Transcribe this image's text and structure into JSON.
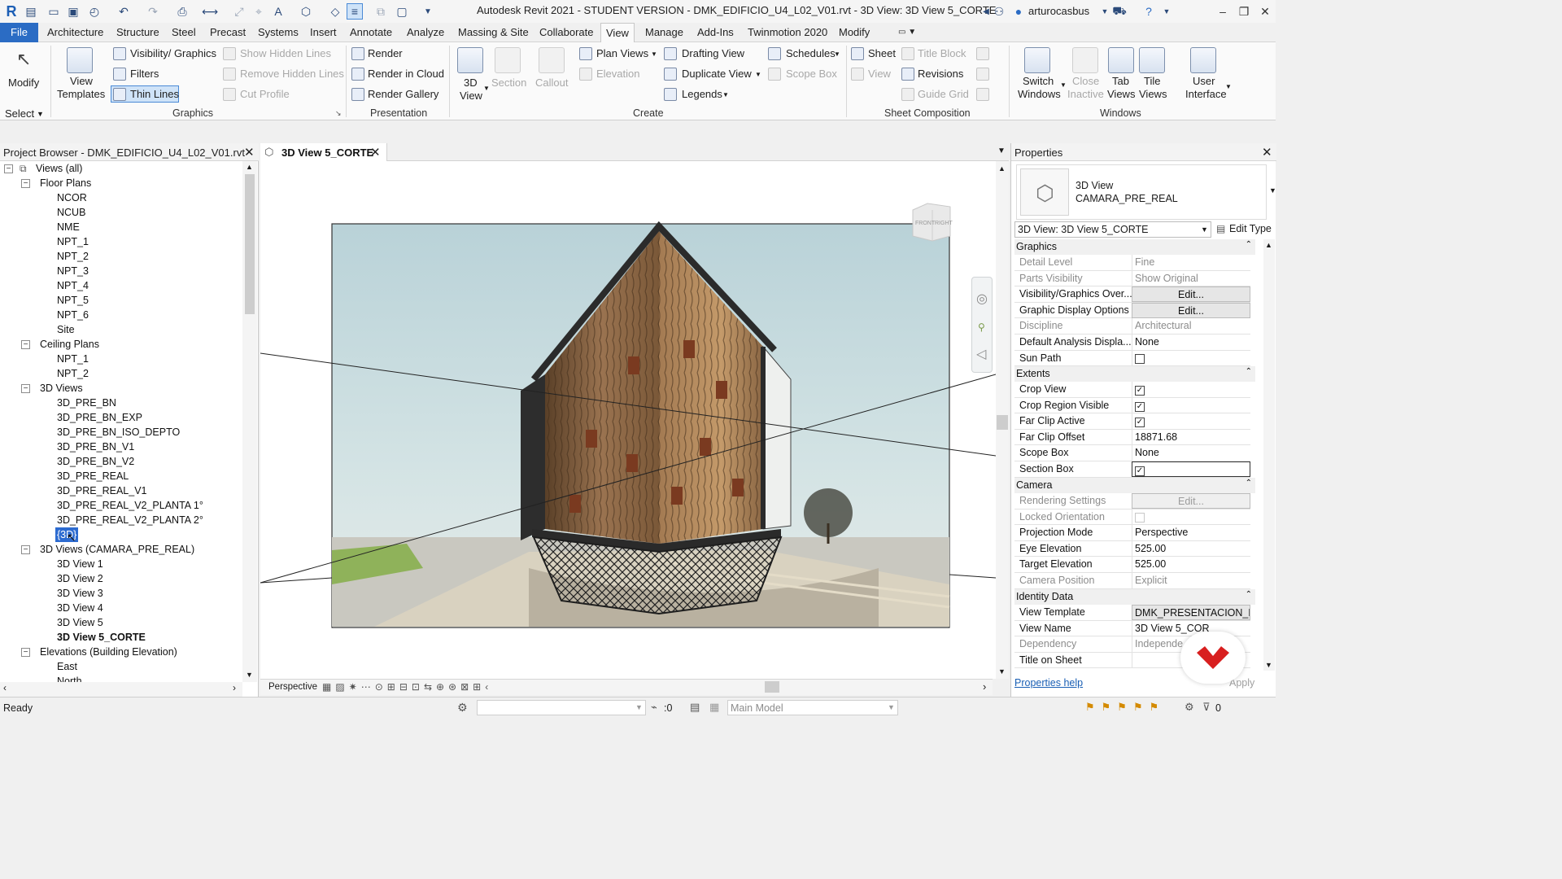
{
  "app": {
    "title": "Autodesk Revit 2021 - STUDENT VERSION - DMK_EDIFICIO_U4_L02_V01.rvt - 3D View: 3D View 5_CORTE",
    "user": "arturocasbus",
    "logo": "R"
  },
  "menu": [
    "File",
    "Architecture",
    "Structure",
    "Steel",
    "Precast",
    "Systems",
    "Insert",
    "Annotate",
    "Analyze",
    "Massing & Site",
    "Collaborate",
    "View",
    "Manage",
    "Add-Ins",
    "Twinmotion 2020",
    "Modify"
  ],
  "ribbon": {
    "select": {
      "modify": "Modify",
      "select": "Select"
    },
    "graphics": {
      "view_templates_1": "View",
      "view_templates_2": "Templates",
      "visibility": "Visibility/ Graphics",
      "filters": "Filters",
      "thin_lines": "Thin Lines",
      "show_hidden": "Show Hidden Lines",
      "remove_hidden": "Remove Hidden Lines",
      "cut_profile": "Cut Profile",
      "title": "Graphics"
    },
    "presentation": {
      "render": "Render",
      "render_cloud": "Render in Cloud",
      "render_gallery": "Render Gallery",
      "title": "Presentation"
    },
    "create": {
      "view3d_1": "3D",
      "view3d_2": "View",
      "section": "Section",
      "callout": "Callout",
      "plan_views": "Plan Views",
      "elevation": "Elevation",
      "drafting_view": "Drafting View",
      "duplicate_view": "Duplicate View",
      "legends": "Legends",
      "schedules": "Schedules",
      "scope_box": "Scope Box",
      "title": "Create"
    },
    "sheet": {
      "sheet": "Sheet",
      "title_block": "Title Block",
      "view": "View",
      "revisions": "Revisions",
      "guide_grid": "Guide Grid",
      "title": "Sheet Composition"
    },
    "windows": {
      "switch_1": "Switch",
      "switch_2": "Windows",
      "close_1": "Close",
      "close_2": "Inactive",
      "tab_1": "Tab",
      "tab_2": "Views",
      "tile_1": "Tile",
      "tile_2": "Views",
      "ui_1": "User",
      "ui_2": "Interface",
      "title": "Windows"
    }
  },
  "project_browser": {
    "title": "Project Browser - DMK_EDIFICIO_U4_L02_V01.rvt",
    "root": "Views (all)",
    "groups": [
      {
        "label": "Floor Plans",
        "items": [
          "NCOR",
          "NCUB",
          "NME",
          "NPT_1",
          "NPT_2",
          "NPT_3",
          "NPT_4",
          "NPT_5",
          "NPT_6",
          "Site"
        ]
      },
      {
        "label": "Ceiling Plans",
        "items": [
          "NPT_1",
          "NPT_2"
        ]
      },
      {
        "label": "3D Views",
        "items": [
          "3D_PRE_BN",
          "3D_PRE_BN_EXP",
          "3D_PRE_BN_ISO_DEPTO",
          "3D_PRE_BN_V1",
          "3D_PRE_BN_V2",
          "3D_PRE_REAL",
          "3D_PRE_REAL_V1",
          "3D_PRE_REAL_V2_PLANTA 1°",
          "3D_PRE_REAL_V2_PLANTA 2°",
          "{3D}"
        ]
      },
      {
        "label": "3D Views (CAMARA_PRE_REAL)",
        "items": [
          "3D View 1",
          "3D View 2",
          "3D View 3",
          "3D View 4",
          "3D View 5",
          "3D View 5_CORTE"
        ]
      },
      {
        "label": "Elevations (Building Elevation)",
        "items": [
          "East",
          "North"
        ]
      }
    ]
  },
  "view_tab": {
    "label": "3D View 5_CORTE"
  },
  "viewcube": {
    "front": "FRONT",
    "right": "RIGHT"
  },
  "view_control": {
    "projection": "Perspective"
  },
  "properties": {
    "title": "Properties",
    "type_line1": "3D View",
    "type_line2": "CAMARA_PRE_REAL",
    "instance_selector": "3D View: 3D View 5_CORTE",
    "edit_type": "Edit Type",
    "groups": {
      "graphics": "Graphics",
      "extents": "Extents",
      "camera": "Camera",
      "identity": "Identity Data"
    },
    "rows": {
      "detail_level": {
        "name": "Detail Level",
        "value": "Fine"
      },
      "parts_visibility": {
        "name": "Parts Visibility",
        "value": "Show Original"
      },
      "vg_overrides": {
        "name": "Visibility/Graphics Over...",
        "value": "Edit..."
      },
      "graphic_display": {
        "name": "Graphic Display Options",
        "value": "Edit..."
      },
      "discipline": {
        "name": "Discipline",
        "value": "Architectural"
      },
      "default_analysis": {
        "name": "Default Analysis Displa...",
        "value": "None"
      },
      "sun_path": {
        "name": "Sun Path",
        "value": ""
      },
      "crop_view": {
        "name": "Crop View",
        "value": "✓"
      },
      "crop_region_visible": {
        "name": "Crop Region Visible",
        "value": "✓"
      },
      "far_clip_active": {
        "name": "Far Clip Active",
        "value": "✓"
      },
      "far_clip_offset": {
        "name": "Far Clip Offset",
        "value": "18871.68"
      },
      "scope_box": {
        "name": "Scope Box",
        "value": "None"
      },
      "section_box": {
        "name": "Section Box",
        "value": "✓"
      },
      "rendering_settings": {
        "name": "Rendering Settings",
        "value": "Edit..."
      },
      "locked_orientation": {
        "name": "Locked Orientation",
        "value": ""
      },
      "projection_mode": {
        "name": "Projection Mode",
        "value": "Perspective"
      },
      "eye_elevation": {
        "name": "Eye Elevation",
        "value": "525.00"
      },
      "target_elevation": {
        "name": "Target Elevation",
        "value": "525.00"
      },
      "camera_position": {
        "name": "Camera Position",
        "value": "Explicit"
      },
      "view_template": {
        "name": "View Template",
        "value": "DMK_PRESENTACION_RE"
      },
      "view_name": {
        "name": "View Name",
        "value": "3D View 5_COR"
      },
      "dependency": {
        "name": "Dependency",
        "value": "Independe"
      },
      "title_on_sheet": {
        "name": "Title on Sheet",
        "value": ""
      }
    },
    "help": "Properties help",
    "apply": "Apply"
  },
  "status": {
    "ready": "Ready",
    "zero1": ":0",
    "main_model": "Main Model",
    "filter_count": "0"
  }
}
